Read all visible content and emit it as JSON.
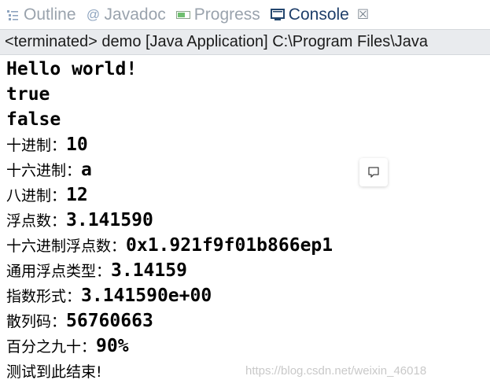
{
  "tabs": [
    {
      "label": "Outline",
      "icon": "outline-icon",
      "active": false
    },
    {
      "label": "Javadoc",
      "icon": "javadoc-icon",
      "active": false
    },
    {
      "label": "Progress",
      "icon": "progress-icon",
      "active": false
    },
    {
      "label": "Console",
      "icon": "console-icon",
      "active": true,
      "close": "☒"
    }
  ],
  "status": "<terminated> demo [Java Application] C:\\Program Files\\Java",
  "console_lines": [
    {
      "text": "Hello world!"
    },
    {
      "text": "true"
    },
    {
      "text": "false"
    },
    {
      "label": "十进制：",
      "value": "10"
    },
    {
      "label": "十六进制：",
      "value": "a"
    },
    {
      "label": "八进制：",
      "value": "12"
    },
    {
      "label": "浮点数：",
      "value": "3.141590"
    },
    {
      "label": "十六进制浮点数：",
      "value": "0x1.921f9f01b866ep1"
    },
    {
      "label": "通用浮点类型：",
      "value": "3.14159"
    },
    {
      "label": "指数形式：",
      "value": "3.141590e+00"
    },
    {
      "label": "散列码：",
      "value": "56760663"
    },
    {
      "label": "百分之九十：",
      "value": "90%"
    },
    {
      "label": "测试到此结束!",
      "value": ""
    }
  ],
  "watermark": "https://blog.csdn.net/weixin_46018"
}
